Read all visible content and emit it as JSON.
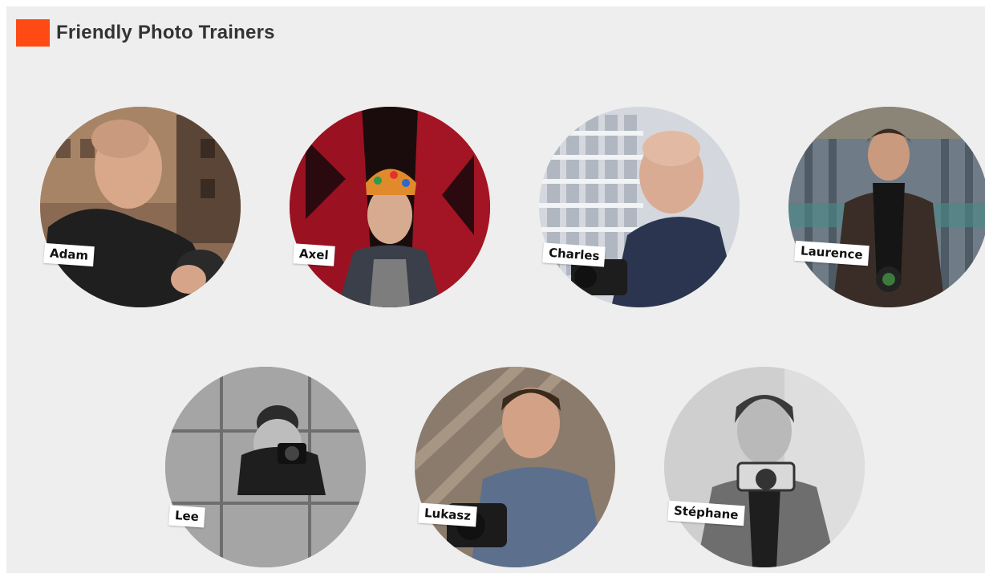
{
  "header": {
    "title": "Friendly Photo Trainers",
    "accent_color": "#ff4a14"
  },
  "trainers": [
    {
      "name": "Adam",
      "photo": "portrait-photo"
    },
    {
      "name": "Axel",
      "photo": "portrait-photo"
    },
    {
      "name": "Charles",
      "photo": "portrait-photo"
    },
    {
      "name": "Laurence",
      "photo": "portrait-photo"
    },
    {
      "name": "Lee",
      "photo": "portrait-photo"
    },
    {
      "name": "Lukasz",
      "photo": "portrait-photo"
    },
    {
      "name": "Stéphane",
      "photo": "portrait-photo"
    }
  ]
}
